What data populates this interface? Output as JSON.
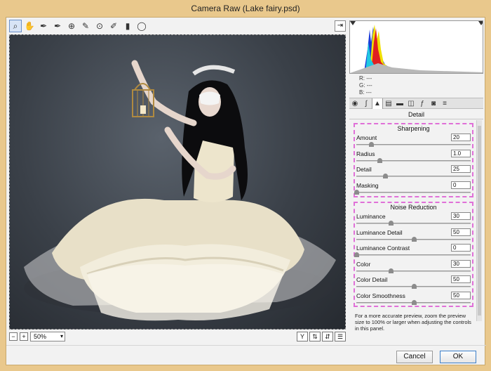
{
  "window": {
    "title": "Camera Raw (Lake fairy.psd)"
  },
  "toolbar": {
    "tools": [
      {
        "name": "zoom-tool",
        "glyph": "🔍"
      },
      {
        "name": "hand-tool",
        "glyph": "✋"
      },
      {
        "name": "white-balance-tool",
        "glyph": "✒"
      },
      {
        "name": "color-sampler-tool",
        "glyph": "✒"
      },
      {
        "name": "targeted-adjustment-tool",
        "glyph": "⊕"
      },
      {
        "name": "spot-removal-tool",
        "glyph": "✎"
      },
      {
        "name": "red-eye-tool",
        "glyph": "⊙"
      },
      {
        "name": "adjustment-brush-tool",
        "glyph": "✐"
      },
      {
        "name": "graduated-filter-tool",
        "glyph": "▮"
      },
      {
        "name": "radial-filter-tool",
        "glyph": "◯"
      }
    ]
  },
  "zoom": {
    "value": "50%"
  },
  "rgb": {
    "r_label": "R:",
    "g_label": "G:",
    "b_label": "B:",
    "r": "---",
    "g": "---",
    "b": "---"
  },
  "panel": {
    "title": "Detail",
    "sharpening": {
      "title": "Sharpening",
      "controls": [
        {
          "label": "Amount",
          "value": "20",
          "fraction": 0.13
        },
        {
          "label": "Radius",
          "value": "1.0",
          "fraction": 0.2
        },
        {
          "label": "Detail",
          "value": "25",
          "fraction": 0.25
        },
        {
          "label": "Masking",
          "value": "0",
          "fraction": 0.0
        }
      ]
    },
    "noise": {
      "title": "Noise Reduction",
      "controls": [
        {
          "label": "Luminance",
          "value": "30",
          "fraction": 0.3
        },
        {
          "label": "Luminance Detail",
          "value": "50",
          "fraction": 0.5
        },
        {
          "label": "Luminance Contrast",
          "value": "0",
          "fraction": 0.0
        },
        {
          "label": "Color",
          "value": "30",
          "fraction": 0.3
        },
        {
          "label": "Color Detail",
          "value": "50",
          "fraction": 0.5
        },
        {
          "label": "Color Smoothness",
          "value": "50",
          "fraction": 0.5
        }
      ]
    },
    "note": "For a more accurate preview, zoom the preview size to 100% or larger when adjusting the controls in this panel."
  },
  "buttons": {
    "cancel": "Cancel",
    "ok": "OK"
  }
}
